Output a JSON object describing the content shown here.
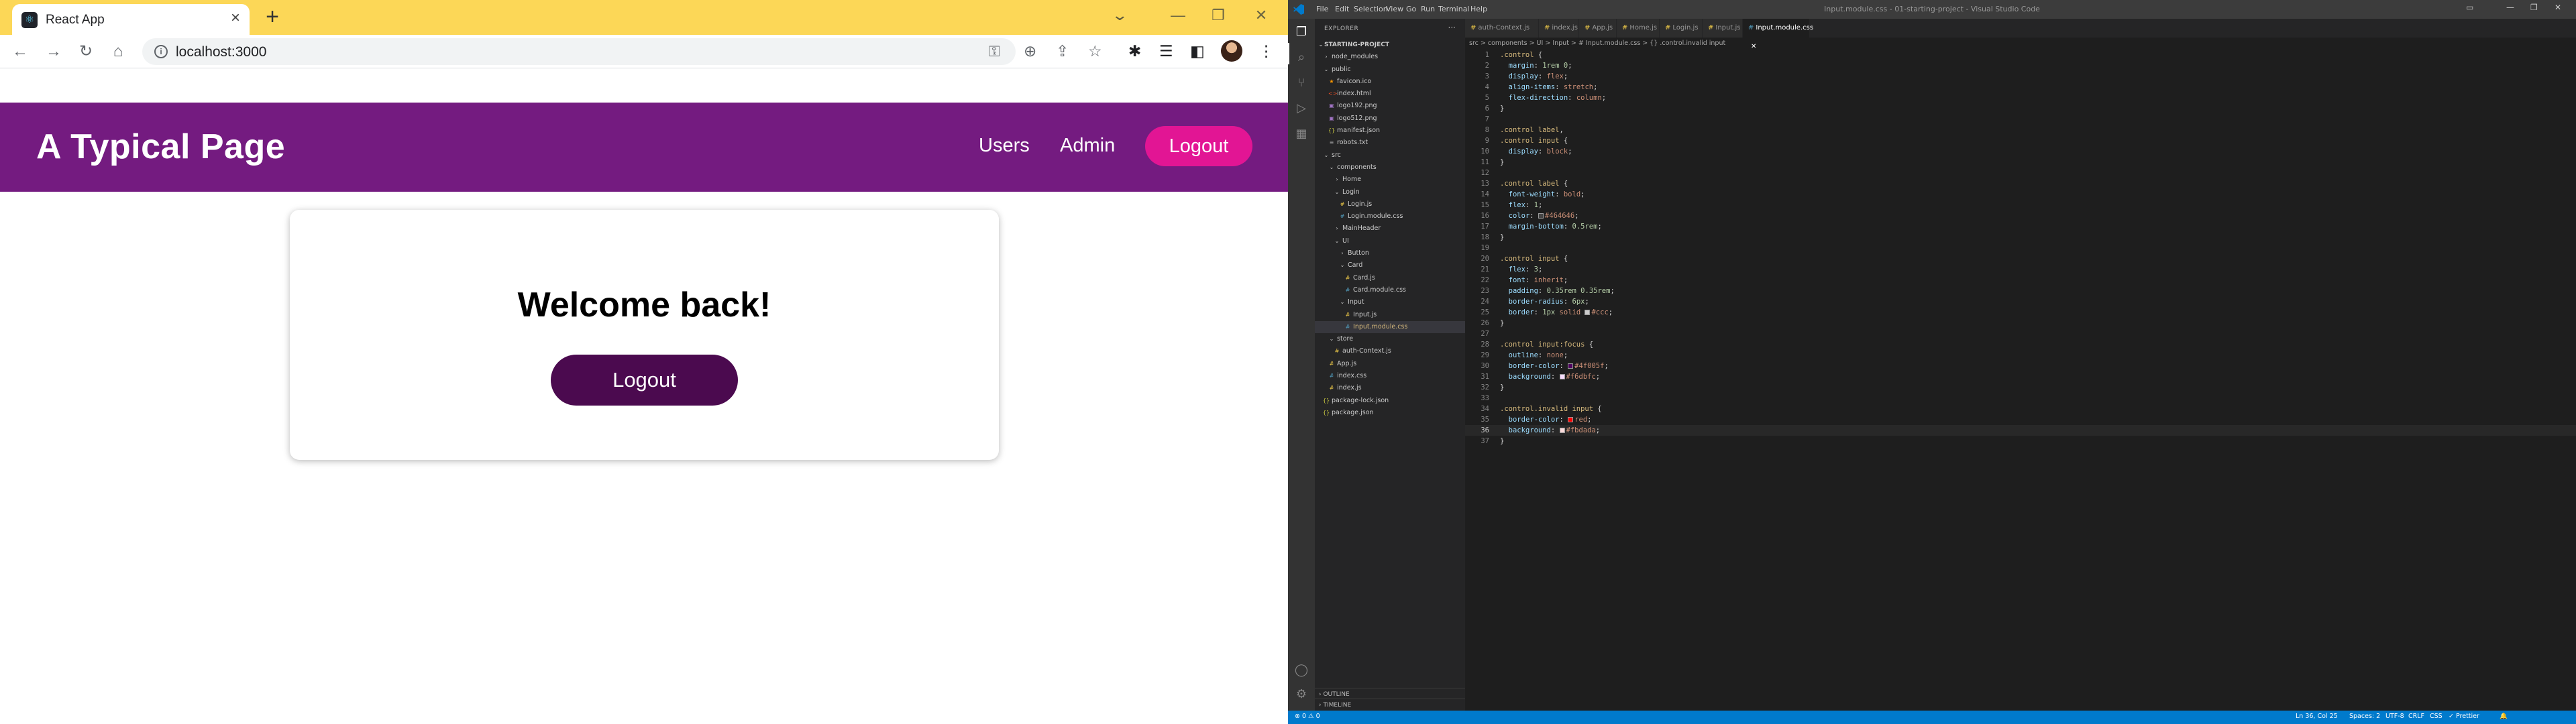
{
  "browser": {
    "tab_title": "React App",
    "tab_close": "×",
    "new_tab": "+",
    "url": "localhost:3000",
    "tab_search": "⌄",
    "win_min": "—",
    "win_restore": "❐",
    "win_close": "✕"
  },
  "app": {
    "title": "A Typical Page",
    "nav": [
      "Users",
      "Admin"
    ],
    "logout_label": "Logout",
    "card_heading": "Welcome back!",
    "card_button_label": "Logout"
  },
  "vscode": {
    "menu": [
      "File",
      "Edit",
      "Selection",
      "View",
      "Go",
      "Run",
      "Terminal",
      "Help"
    ],
    "window_title": "Input.module.css - 01-starting-project - Visual Studio Code",
    "explorer_title": "EXPLORER",
    "project_name": "STARTING-PROJECT",
    "tree": [
      {
        "label": "node_modules",
        "type": "folder",
        "open": false,
        "depth": 1
      },
      {
        "label": "public",
        "type": "folder",
        "open": true,
        "depth": 1
      },
      {
        "label": "favicon.ico",
        "type": "star",
        "depth": 2
      },
      {
        "label": "index.html",
        "type": "html",
        "depth": 2
      },
      {
        "label": "logo192.png",
        "type": "img",
        "depth": 2
      },
      {
        "label": "logo512.png",
        "type": "img",
        "depth": 2
      },
      {
        "label": "manifest.json",
        "type": "json",
        "depth": 2
      },
      {
        "label": "robots.txt",
        "type": "txt",
        "depth": 2
      },
      {
        "label": "src",
        "type": "folder",
        "open": true,
        "depth": 1
      },
      {
        "label": "components",
        "type": "folder",
        "open": true,
        "depth": 2
      },
      {
        "label": "Home",
        "type": "folder",
        "open": false,
        "depth": 3
      },
      {
        "label": "Login",
        "type": "folder",
        "open": true,
        "depth": 3
      },
      {
        "label": "Login.js",
        "type": "js",
        "depth": 4
      },
      {
        "label": "Login.module.css",
        "type": "css",
        "depth": 4
      },
      {
        "label": "MainHeader",
        "type": "folder",
        "open": false,
        "depth": 3
      },
      {
        "label": "UI",
        "type": "folder",
        "open": true,
        "depth": 3
      },
      {
        "label": "Button",
        "type": "folder",
        "open": false,
        "depth": 4
      },
      {
        "label": "Card",
        "type": "folder",
        "open": true,
        "depth": 4
      },
      {
        "label": "Card.js",
        "type": "js",
        "depth": 5
      },
      {
        "label": "Card.module.css",
        "type": "css",
        "depth": 5
      },
      {
        "label": "Input",
        "type": "folder",
        "open": true,
        "depth": 4
      },
      {
        "label": "Input.js",
        "type": "js",
        "depth": 5
      },
      {
        "label": "Input.module.css",
        "type": "css",
        "depth": 5,
        "selected": true
      },
      {
        "label": "store",
        "type": "folder",
        "open": true,
        "depth": 2
      },
      {
        "label": "auth-Context.js",
        "type": "js",
        "depth": 3
      },
      {
        "label": "App.js",
        "type": "js",
        "depth": 2
      },
      {
        "label": "index.css",
        "type": "css",
        "depth": 2
      },
      {
        "label": "index.js",
        "type": "js",
        "depth": 2
      },
      {
        "label": "package-lock.json",
        "type": "json",
        "depth": 1
      },
      {
        "label": "package.json",
        "type": "json",
        "depth": 1
      }
    ],
    "outline_label": "OUTLINE",
    "timeline_label": "TIMELINE",
    "tabs": [
      {
        "label": "auth-Context.js",
        "kind": "js"
      },
      {
        "label": "index.js",
        "kind": "js"
      },
      {
        "label": "App.js",
        "kind": "js"
      },
      {
        "label": "Home.js",
        "kind": "js"
      },
      {
        "label": "Login.js",
        "kind": "js"
      },
      {
        "label": "Input.js",
        "kind": "js"
      },
      {
        "label": "Input.module.css",
        "kind": "css",
        "active": true
      }
    ],
    "breadcrumbs": "src > components > UI > Input > # Input.module.css > {} .control.invalid input",
    "current_line": 36,
    "code": [
      [
        [
          "sel",
          ".control"
        ],
        [
          "punc",
          " {"
        ]
      ],
      [
        [
          "punc",
          "  "
        ],
        [
          "prop",
          "margin"
        ],
        [
          "punc",
          ": "
        ],
        [
          "num",
          "1rem"
        ],
        [
          "punc",
          " "
        ],
        [
          "num",
          "0"
        ],
        [
          "punc",
          ";"
        ]
      ],
      [
        [
          "punc",
          "  "
        ],
        [
          "prop",
          "display"
        ],
        [
          "punc",
          ": "
        ],
        [
          "val",
          "flex"
        ],
        [
          "punc",
          ";"
        ]
      ],
      [
        [
          "punc",
          "  "
        ],
        [
          "prop",
          "align-items"
        ],
        [
          "punc",
          ": "
        ],
        [
          "val",
          "stretch"
        ],
        [
          "punc",
          ";"
        ]
      ],
      [
        [
          "punc",
          "  "
        ],
        [
          "prop",
          "flex-direction"
        ],
        [
          "punc",
          ": "
        ],
        [
          "val",
          "column"
        ],
        [
          "punc",
          ";"
        ]
      ],
      [
        [
          "punc",
          "}"
        ]
      ],
      [],
      [
        [
          "sel",
          ".control label"
        ],
        [
          "punc",
          ","
        ]
      ],
      [
        [
          "sel",
          ".control input"
        ],
        [
          "punc",
          " {"
        ]
      ],
      [
        [
          "punc",
          "  "
        ],
        [
          "prop",
          "display"
        ],
        [
          "punc",
          ": "
        ],
        [
          "val",
          "block"
        ],
        [
          "punc",
          ";"
        ]
      ],
      [
        [
          "punc",
          "}"
        ]
      ],
      [],
      [
        [
          "sel",
          ".control label"
        ],
        [
          "punc",
          " {"
        ]
      ],
      [
        [
          "punc",
          "  "
        ],
        [
          "prop",
          "font-weight"
        ],
        [
          "punc",
          ": "
        ],
        [
          "val",
          "bold"
        ],
        [
          "punc",
          ";"
        ]
      ],
      [
        [
          "punc",
          "  "
        ],
        [
          "prop",
          "flex"
        ],
        [
          "punc",
          ": "
        ],
        [
          "num",
          "1"
        ],
        [
          "punc",
          ";"
        ]
      ],
      [
        [
          "punc",
          "  "
        ],
        [
          "prop",
          "color"
        ],
        [
          "punc",
          ": "
        ],
        [
          "swatch",
          "#464646"
        ],
        [
          "val",
          "#464646"
        ],
        [
          "punc",
          ";"
        ]
      ],
      [
        [
          "punc",
          "  "
        ],
        [
          "prop",
          "margin-bottom"
        ],
        [
          "punc",
          ": "
        ],
        [
          "num",
          "0.5rem"
        ],
        [
          "punc",
          ";"
        ]
      ],
      [
        [
          "punc",
          "}"
        ]
      ],
      [],
      [
        [
          "sel",
          ".control input"
        ],
        [
          "punc",
          " {"
        ]
      ],
      [
        [
          "punc",
          "  "
        ],
        [
          "prop",
          "flex"
        ],
        [
          "punc",
          ": "
        ],
        [
          "num",
          "3"
        ],
        [
          "punc",
          ";"
        ]
      ],
      [
        [
          "punc",
          "  "
        ],
        [
          "prop",
          "font"
        ],
        [
          "punc",
          ": "
        ],
        [
          "val",
          "inherit"
        ],
        [
          "punc",
          ";"
        ]
      ],
      [
        [
          "punc",
          "  "
        ],
        [
          "prop",
          "padding"
        ],
        [
          "punc",
          ": "
        ],
        [
          "num",
          "0.35rem"
        ],
        [
          "punc",
          " "
        ],
        [
          "num",
          "0.35rem"
        ],
        [
          "punc",
          ";"
        ]
      ],
      [
        [
          "punc",
          "  "
        ],
        [
          "prop",
          "border-radius"
        ],
        [
          "punc",
          ": "
        ],
        [
          "num",
          "6px"
        ],
        [
          "punc",
          ";"
        ]
      ],
      [
        [
          "punc",
          "  "
        ],
        [
          "prop",
          "border"
        ],
        [
          "punc",
          ": "
        ],
        [
          "num",
          "1px"
        ],
        [
          "punc",
          " "
        ],
        [
          "val",
          "solid"
        ],
        [
          "punc",
          " "
        ],
        [
          "swatch",
          "#ccc"
        ],
        [
          "val",
          "#ccc"
        ],
        [
          "punc",
          ";"
        ]
      ],
      [
        [
          "punc",
          "}"
        ]
      ],
      [],
      [
        [
          "sel",
          ".control input:focus"
        ],
        [
          "punc",
          " {"
        ]
      ],
      [
        [
          "punc",
          "  "
        ],
        [
          "prop",
          "outline"
        ],
        [
          "punc",
          ": "
        ],
        [
          "val",
          "none"
        ],
        [
          "punc",
          ";"
        ]
      ],
      [
        [
          "punc",
          "  "
        ],
        [
          "prop",
          "border-color"
        ],
        [
          "punc",
          ": "
        ],
        [
          "swatch",
          "#4f005f"
        ],
        [
          "val",
          "#4f005f"
        ],
        [
          "punc",
          ";"
        ]
      ],
      [
        [
          "punc",
          "  "
        ],
        [
          "prop",
          "background"
        ],
        [
          "punc",
          ": "
        ],
        [
          "swatch",
          "#f6dbfc"
        ],
        [
          "val",
          "#f6dbfc"
        ],
        [
          "punc",
          ";"
        ]
      ],
      [
        [
          "punc",
          "}"
        ]
      ],
      [],
      [
        [
          "sel",
          ".control.invalid input"
        ],
        [
          "punc",
          " {"
        ]
      ],
      [
        [
          "punc",
          "  "
        ],
        [
          "prop",
          "border-color"
        ],
        [
          "punc",
          ": "
        ],
        [
          "swatch",
          "red"
        ],
        [
          "val",
          "red"
        ],
        [
          "punc",
          ";"
        ]
      ],
      [
        [
          "punc",
          "  "
        ],
        [
          "prop",
          "background"
        ],
        [
          "punc",
          ": "
        ],
        [
          "swatch",
          "#fbdada"
        ],
        [
          "val",
          "#fbdada"
        ],
        [
          "punc",
          ";"
        ]
      ],
      [
        [
          "punc",
          "}"
        ]
      ]
    ],
    "status_left": "⊗ 0  ⚠ 0",
    "status_right": [
      "Ln 36, Col 25",
      "Spaces: 2",
      "UTF-8",
      "CRLF",
      "CSS",
      "✓ Prettier",
      "🔔"
    ]
  },
  "colors": {
    "tabstrip": "#fcd757",
    "app_header": "#741b80",
    "header_logout": "#e21594",
    "card_button": "#4b0a4f",
    "vscode_status": "#007acc"
  }
}
